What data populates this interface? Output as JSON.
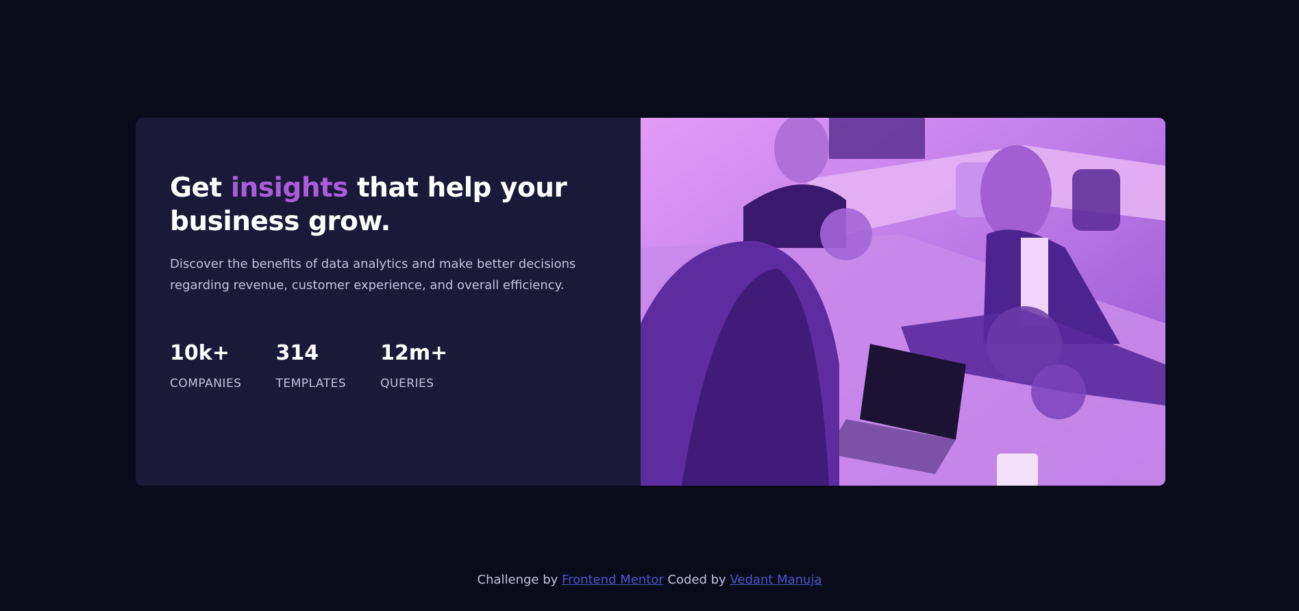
{
  "hero": {
    "headline_before": "Get",
    "headline_accent": "insights",
    "headline_after": "that help your business grow.",
    "description": "Discover the benefits of data analytics and make better decisions regarding revenue, customer experience, and overall efficiency."
  },
  "stats": [
    {
      "value": "10k+",
      "label": "COMPANIES"
    },
    {
      "value": "314",
      "label": "TEMPLATES"
    },
    {
      "value": "12m+",
      "label": "QUERIES"
    }
  ],
  "image": {
    "description": "people working at a table"
  },
  "footer": {
    "challenge_text": "Challenge by",
    "challenge_link": "Frontend Mentor",
    "coded_text": "Coded by",
    "author_link": "Vedant Manuja"
  },
  "colors": {
    "background": "#090b1b",
    "card": "#1b1938",
    "accent": "#aa5cdb",
    "link": "#4c56c9"
  }
}
